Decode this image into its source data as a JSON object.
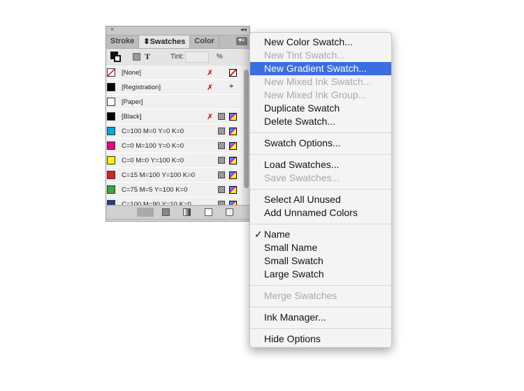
{
  "panel": {
    "close_icon": "×",
    "collapse_icon": "◂◂",
    "tabs": [
      {
        "label": "Stroke"
      },
      {
        "label": "⬍Swatches"
      },
      {
        "label": "Color"
      }
    ],
    "tint_label": "Tint:",
    "tint_value": "",
    "percent": "%",
    "swatches": [
      {
        "name": "[None]",
        "color": "#ffffff",
        "none": true,
        "icons": [
          "no-edit",
          "none"
        ]
      },
      {
        "name": "[Registration]",
        "color": "#000000",
        "icons": [
          "no-edit",
          "registration"
        ]
      },
      {
        "name": "[Paper]",
        "color": "#ffffff",
        "icons": []
      },
      {
        "name": "[Black]",
        "color": "#000000",
        "icons": [
          "no-edit",
          "process",
          "cmyk"
        ]
      },
      {
        "name": "C=100 M=0 Y=0 K=0",
        "color": "#00a6e0",
        "icons": [
          "process",
          "cmyk"
        ]
      },
      {
        "name": "C=0 M=100 Y=0 K=0",
        "color": "#e4008c",
        "icons": [
          "process",
          "cmyk"
        ]
      },
      {
        "name": "C=0 M=0 Y=100 K=0",
        "color": "#fff200",
        "icons": [
          "process",
          "cmyk"
        ]
      },
      {
        "name": "C=15 M=100 Y=100 K=0",
        "color": "#d71f26",
        "icons": [
          "process",
          "cmyk"
        ]
      },
      {
        "name": "C=75 M=5 Y=100 K=0",
        "color": "#3aa83e",
        "icons": [
          "process",
          "cmyk"
        ]
      },
      {
        "name": "C=100 M=90 Y=10 K=0",
        "color": "#2b3990",
        "icons": [
          "process",
          "cmyk"
        ]
      }
    ]
  },
  "menu": {
    "accent": "#3b6ee0",
    "items": [
      {
        "label": "New Color Swatch...",
        "state": "enabled"
      },
      {
        "label": "New Tint Swatch...",
        "state": "disabled"
      },
      {
        "label": "New Gradient Swatch...",
        "state": "highlighted"
      },
      {
        "label": "New Mixed Ink Swatch...",
        "state": "disabled"
      },
      {
        "label": "New Mixed Ink Group...",
        "state": "disabled"
      },
      {
        "label": "Duplicate Swatch",
        "state": "enabled"
      },
      {
        "label": "Delete Swatch...",
        "state": "enabled"
      },
      {
        "label": "Swatch Options...",
        "state": "enabled"
      },
      {
        "label": "Load Swatches...",
        "state": "enabled"
      },
      {
        "label": "Save Swatches...",
        "state": "disabled"
      },
      {
        "label": "Select All Unused",
        "state": "enabled"
      },
      {
        "label": "Add Unnamed Colors",
        "state": "enabled"
      },
      {
        "label": "Name",
        "state": "enabled",
        "checked": true
      },
      {
        "label": "Small Name",
        "state": "enabled"
      },
      {
        "label": "Small Swatch",
        "state": "enabled"
      },
      {
        "label": "Large Swatch",
        "state": "enabled"
      },
      {
        "label": "Merge Swatches",
        "state": "disabled"
      },
      {
        "label": "Ink Manager...",
        "state": "enabled"
      },
      {
        "label": "Hide Options",
        "state": "enabled"
      }
    ],
    "check_mark": "✓"
  }
}
